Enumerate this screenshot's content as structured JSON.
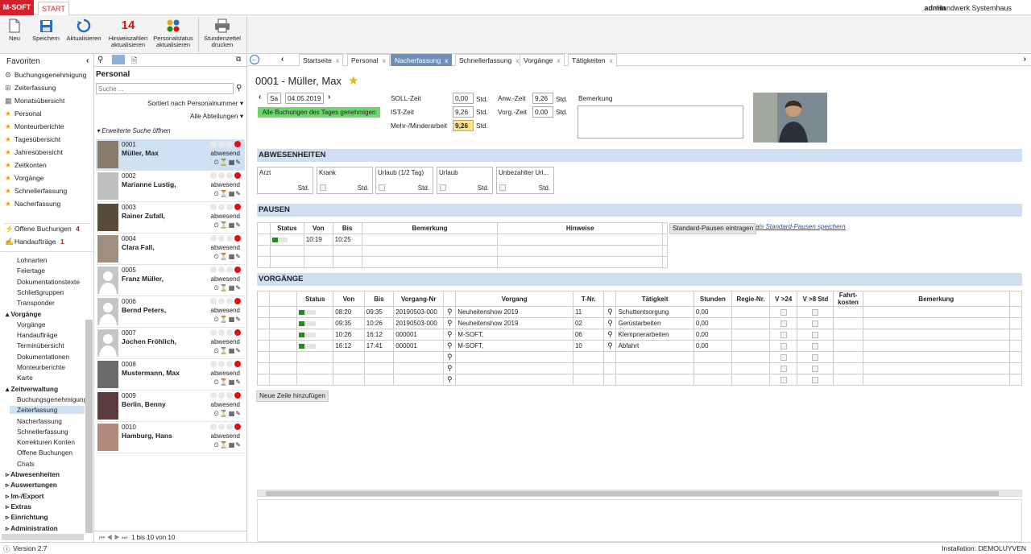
{
  "app": {
    "logo": "M-SOFT",
    "tab": "START",
    "user": "admin",
    "company": "Handwerk Systemhaus"
  },
  "ribbon": {
    "new": "Neu",
    "save": "Speichern",
    "refresh": "Aktualisieren",
    "hint_count": "14",
    "hint_line1": "Hinweiszahlen",
    "hint_line2": "aktualisieren",
    "status_line1": "Personalstatus",
    "status_line2": "aktualisieren",
    "print_line1": "Stundenzettel",
    "print_line2": "drucken"
  },
  "sidebar": {
    "title": "Favoriten",
    "favorites": [
      "Buchungsgenehmigung",
      "Zeiterfassung",
      "Monatsübersicht",
      "Personal",
      "Monteurberichte",
      "Tagesübersicht",
      "Jahresübersicht",
      "Zeitkonten",
      "Vorgänge",
      "Schnellerfassung",
      "Nacherfassung"
    ],
    "offene": {
      "label": "Offene Buchungen",
      "count": "4"
    },
    "hand": {
      "label": "Handaufträge",
      "count": "1"
    },
    "tree": [
      {
        "t": "Lohnarten",
        "h": false
      },
      {
        "t": "Feiertage",
        "h": false
      },
      {
        "t": "Dokumentationstexte",
        "h": false
      },
      {
        "t": "Schließgruppen",
        "h": false
      },
      {
        "t": "Transponder",
        "h": false
      },
      {
        "t": "▴ Vorgänge",
        "h": true
      },
      {
        "t": "Vorgänge",
        "h": false
      },
      {
        "t": "Handaufträge",
        "h": false
      },
      {
        "t": "Terminübersicht",
        "h": false
      },
      {
        "t": "Dokumentationen",
        "h": false
      },
      {
        "t": "Monteurberichte",
        "h": false
      },
      {
        "t": "Karte",
        "h": false
      },
      {
        "t": "▴ Zeitverwaltung",
        "h": true
      },
      {
        "t": "Buchungsgenehmigung",
        "h": false
      },
      {
        "t": "Zeiterfassung",
        "h": false,
        "sel": true
      },
      {
        "t": "Nacherfassung",
        "h": false
      },
      {
        "t": "Schnellerfassung",
        "h": false
      },
      {
        "t": "Korrekturen Konten",
        "h": false
      },
      {
        "t": "Offene Buchungen",
        "h": false
      },
      {
        "t": "Chats",
        "h": false
      },
      {
        "t": "▹ Abwesenheiten",
        "h": true
      },
      {
        "t": "▹ Auswertungen",
        "h": true
      },
      {
        "t": "▹ Im-/Export",
        "h": true
      },
      {
        "t": "▹ Extras",
        "h": true
      },
      {
        "t": "▹ Einrichtung",
        "h": true
      },
      {
        "t": "▹ Administration",
        "h": true
      }
    ]
  },
  "personal": {
    "title": "Personal",
    "search_placeholder": "Suche ...",
    "sort": "Sortiert nach Personalnummer",
    "dept": "Alle Abteilungen",
    "ext": "Erweiterte Suche öffnen",
    "rows": [
      {
        "num": "0001",
        "name": "Müller, Max",
        "status": "abwesend"
      },
      {
        "num": "0002",
        "name": "Marianne Lustig,",
        "status": "abwesend"
      },
      {
        "num": "0003",
        "name": "Rainer Zufall,",
        "status": "abwesend"
      },
      {
        "num": "0004",
        "name": "Clara Fall,",
        "status": "abwesend"
      },
      {
        "num": "0005",
        "name": "Franz Müller,",
        "status": "abwesend"
      },
      {
        "num": "0006",
        "name": "Bernd Peters,",
        "status": "abwesend"
      },
      {
        "num": "0007",
        "name": "Jochen Fröhlich,",
        "status": "abwesend"
      },
      {
        "num": "0008",
        "name": "Mustermann, Max",
        "status": "abwesend"
      },
      {
        "num": "0009",
        "name": "Berlin, Benny",
        "status": "abwesend"
      },
      {
        "num": "0010",
        "name": "Hamburg, Hans",
        "status": "abwesend"
      }
    ],
    "pager": "1 bis 10 von 10"
  },
  "tabs": [
    "Startseite",
    "Personal",
    "Nacherfassung",
    "Schnellerfassung",
    "Vorgänge",
    "Tätigkeiten"
  ],
  "detail": {
    "title": "0001 - Müller, Max",
    "day": "Sa",
    "date": "04.05.2019",
    "approve": "Alle Buchungen des Tages genehmigen",
    "soll_label": "SOLL-Zeit",
    "soll": "0,00",
    "ist_label": "IST-Zeit",
    "ist": "9,26",
    "mehr_label": "Mehr-/Minderarbeit",
    "mehr": "9,26",
    "anw_label": "Anw.-Zeit",
    "anw": "9,26",
    "vorg_label": "Vorg.-Zeit",
    "vorg": "0,00",
    "std": "Std.",
    "bemerkung": "Bemerkung"
  },
  "abw": {
    "title": "ABWESENHEITEN",
    "items": [
      "Arzt",
      "Krank",
      "Urlaub (1/2 Tag)",
      "Urlaub",
      "Unbezahlter Url..."
    ]
  },
  "pausen": {
    "title": "PAUSEN",
    "headers": [
      "Status",
      "Von",
      "Bis",
      "Bemerkung",
      "Hinweise"
    ],
    "rows": [
      {
        "von": "10:19",
        "bis": "10:25"
      }
    ],
    "btn": "Standard-Pausen eintragen",
    "link": "als Standard-Pausen speichern"
  },
  "vorgaenge": {
    "title": "VORGÄNGE",
    "headers": [
      "Status",
      "Von",
      "Bis",
      "Vorgang-Nr",
      "Vorgang",
      "T-Nr.",
      "Tätigkeit",
      "Stunden",
      "Regie-Nr.",
      "V >24",
      "V >8 Std",
      "Fahrt-kosten",
      "Bemerkung"
    ],
    "rows": [
      {
        "von": "08:20",
        "bis": "09:35",
        "nr": "20190503-000",
        "vorgang": "Neuheitenshow 2019",
        "tnr": "11",
        "taet": "Schuttentsorgung",
        "std": "0,00"
      },
      {
        "von": "09:35",
        "bis": "10:26",
        "nr": "20190503-000",
        "vorgang": "Neuheitenshow 2019",
        "tnr": "02",
        "taet": "Gerüstarbeiten",
        "std": "0,00"
      },
      {
        "von": "10:26",
        "bis": "16:12",
        "nr": "000001",
        "vorgang": "M-SOFT,",
        "tnr": "06",
        "taet": "Klempnerarbeiten",
        "std": "0,00"
      },
      {
        "von": "16:12",
        "bis": "17:41",
        "nr": "000001",
        "vorgang": "M-SOFT,",
        "tnr": "10",
        "taet": "Abfahrt",
        "std": "0,00"
      }
    ],
    "add": "Neue Zeile hinzufügen"
  },
  "footer": {
    "version": "Version 2.7",
    "install": "Installation: DEMOLUYVEN"
  }
}
